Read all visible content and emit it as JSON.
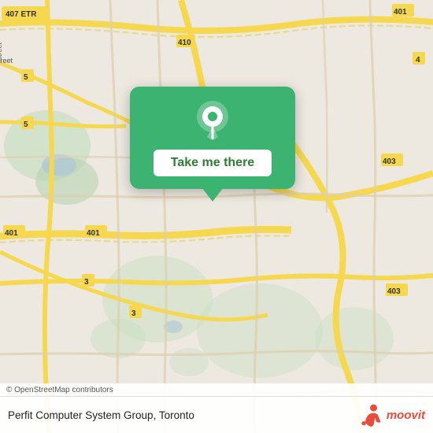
{
  "map": {
    "attribution": "© OpenStreetMap contributors",
    "location_label": "Perfit Computer System Group, Toronto",
    "popup_button_label": "Take me there",
    "bg_color": "#e8ddd0",
    "road_color": "#f5e97a",
    "highway_color": "#f0d060"
  },
  "moovit": {
    "label": "moovit",
    "icon_colors": {
      "person": "#e74c3c",
      "dot": "#e74c3c"
    }
  },
  "pin": {
    "color": "#ffffff"
  }
}
